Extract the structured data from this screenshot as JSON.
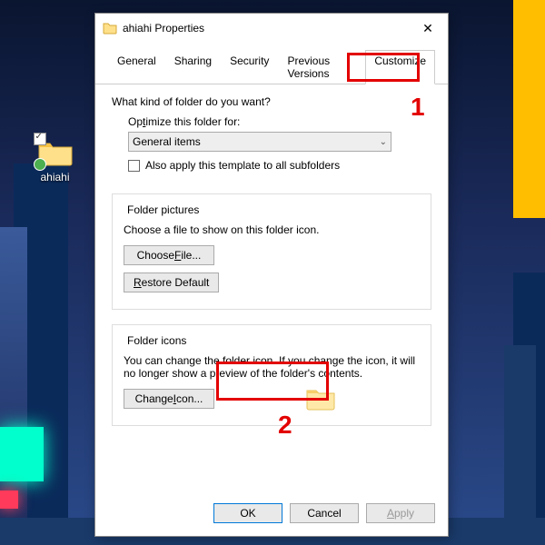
{
  "desktop": {
    "folder_label": "ahiahi"
  },
  "dialog": {
    "title": "ahiahi Properties",
    "tabs": {
      "general": "General",
      "sharing": "Sharing",
      "security": "Security",
      "previous": "Previous Versions",
      "customize": "Customize"
    },
    "section1": {
      "heading": "What kind of folder do you want?",
      "optimize_label_pre": "Op",
      "optimize_label_u": "t",
      "optimize_label_post": "imize this folder for:",
      "dropdown_value": "General items",
      "subfolders_label": "Also apply this template to all subfolders"
    },
    "section2": {
      "title": "Folder pictures",
      "text": "Choose a file to show on this folder icon.",
      "choose_pre": "Choose ",
      "choose_u": "F",
      "choose_post": "ile...",
      "restore_pre": "",
      "restore_u": "R",
      "restore_post": "estore Default"
    },
    "section3": {
      "title": "Folder icons",
      "text": "You can change the folder icon. If you change the icon, it will no longer show a preview of the folder's contents.",
      "change_pre": "Change ",
      "change_u": "I",
      "change_post": "con..."
    },
    "footer": {
      "ok": "OK",
      "cancel": "Cancel",
      "apply_pre": "",
      "apply_u": "A",
      "apply_post": "pply"
    }
  },
  "annotations": {
    "one": "1",
    "two": "2"
  }
}
